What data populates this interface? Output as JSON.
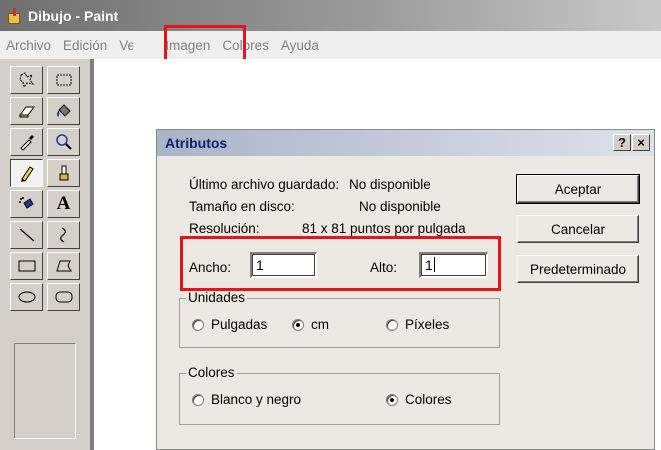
{
  "window": {
    "title": "Dibujo - Paint"
  },
  "menu": {
    "items": [
      {
        "label": "Archivo"
      },
      {
        "label": "Edición"
      },
      {
        "label": "Ver"
      },
      {
        "label": "Imagen"
      },
      {
        "label": "Colores"
      },
      {
        "label": "Ayuda"
      }
    ]
  },
  "toolbox": {
    "tools": [
      "free-form-select-icon",
      "rectangle-select-icon",
      "eraser-icon",
      "fill-bucket-icon",
      "color-picker-icon",
      "magnifier-icon",
      "pencil-icon",
      "brush-icon",
      "airbrush-icon",
      "text-icon",
      "line-icon",
      "curve-icon",
      "rectangle-icon",
      "polygon-icon",
      "ellipse-icon",
      "rounded-rectangle-icon"
    ],
    "selected": "pencil-icon",
    "text_tool_glyph": "A"
  },
  "dialog": {
    "title": "Atributos",
    "help_button": "?",
    "close_button": "×",
    "info": {
      "last_saved_label": "Último archivo guardado:",
      "last_saved_value": "No disponible",
      "disk_size_label": "Tamaño en disco:",
      "disk_size_value": "No disponible",
      "resolution_label": "Resolución:",
      "resolution_value": "81 x 81 puntos por pulgada"
    },
    "width_label": "Ancho:",
    "width_value": "1",
    "height_label": "Alto:",
    "height_value": "1",
    "units": {
      "legend": "Unidades",
      "options": [
        "Pulgadas",
        "cm",
        "Píxeles"
      ],
      "selected": "cm"
    },
    "colors": {
      "legend": "Colores",
      "options": [
        "Blanco y negro",
        "Colores"
      ],
      "selected": "Colores"
    },
    "buttons": {
      "ok": "Aceptar",
      "cancel": "Cancelar",
      "default": "Predeterminado"
    }
  },
  "annotation_color": "#e8141c"
}
